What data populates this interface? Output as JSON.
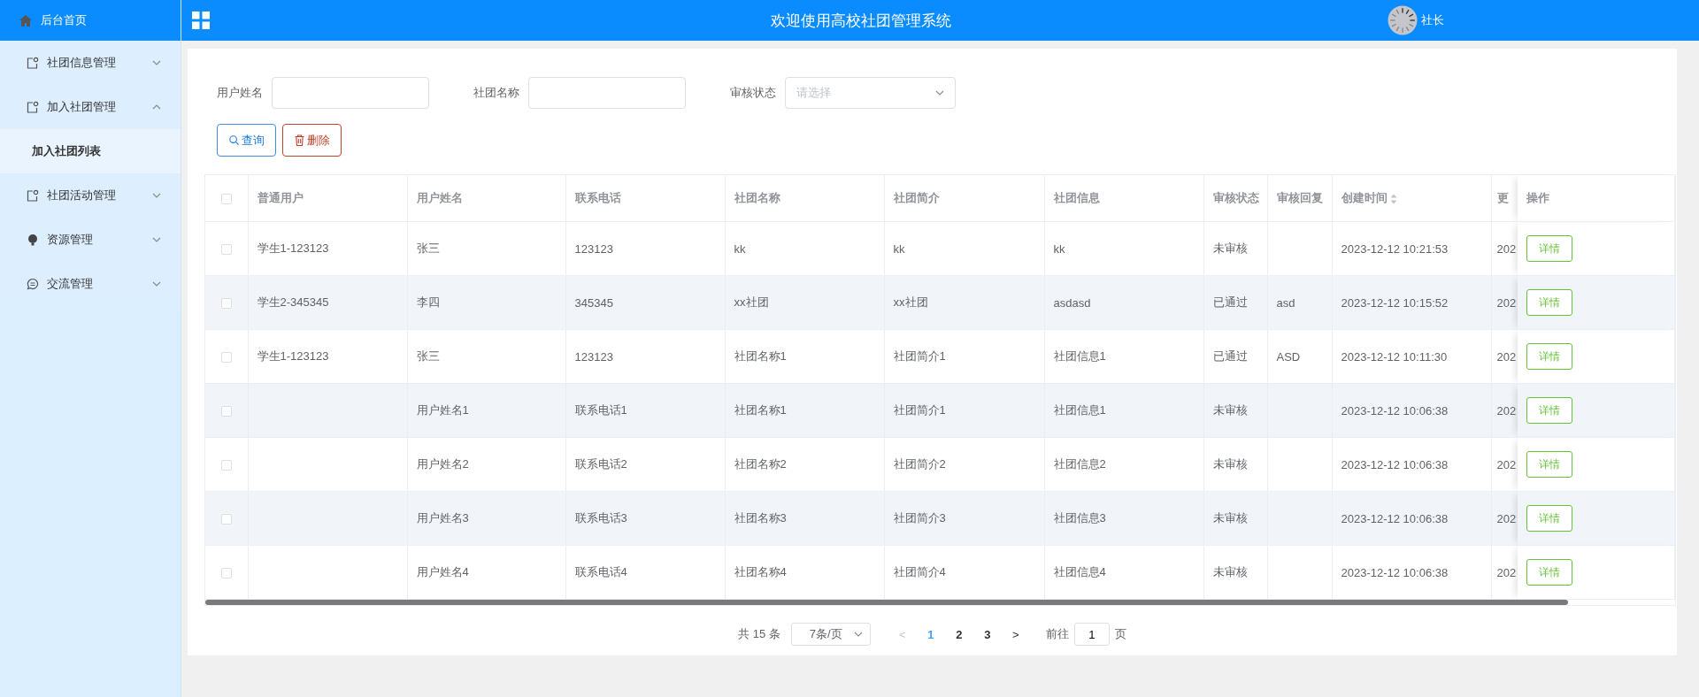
{
  "sidebar": {
    "home": "后台首页",
    "items": [
      {
        "label": "社团信息管理",
        "expanded": false
      },
      {
        "label": "加入社团管理",
        "expanded": true,
        "children": [
          {
            "label": "加入社团列表",
            "selected": true
          }
        ]
      },
      {
        "label": "社团活动管理",
        "expanded": false
      },
      {
        "label": "资源管理",
        "expanded": false
      },
      {
        "label": "交流管理",
        "expanded": false
      }
    ]
  },
  "topbar": {
    "title": "欢迎使用高校社团管理系统",
    "user": "社长"
  },
  "filters": [
    {
      "label": "用户姓名",
      "kind": "text"
    },
    {
      "label": "社团名称",
      "kind": "text"
    },
    {
      "label": "审核状态",
      "kind": "select",
      "placeholder": "请选择"
    }
  ],
  "buttons": [
    {
      "label": "查询",
      "kind": "search"
    },
    {
      "label": "删除",
      "kind": "delete"
    }
  ],
  "table": {
    "select_all": {
      "checked": false
    },
    "columns": [
      {
        "label": "普通用户",
        "kind": "plain"
      },
      {
        "label": "用户姓名",
        "kind": "plain"
      },
      {
        "label": "联系电话",
        "kind": "plain"
      },
      {
        "label": "社团名称",
        "kind": "plain"
      },
      {
        "label": "社团简介",
        "kind": "plain"
      },
      {
        "label": "社团信息",
        "kind": "plain"
      },
      {
        "label": "审核状态",
        "kind": "plain"
      },
      {
        "label": "审核回复",
        "kind": "plain"
      },
      {
        "label": "创建时间",
        "kind": "sortable"
      },
      {
        "label": "更",
        "kind": "plain"
      },
      {
        "label": "操作",
        "kind": "plain"
      }
    ],
    "rows": [
      {
        "checked": false,
        "cells": [
          "学生1-123123",
          "张三",
          "123123",
          "kk",
          "kk",
          "kk",
          "未审核",
          "",
          "2023-12-12 10:21:53",
          "202"
        ],
        "action": "详情"
      },
      {
        "checked": false,
        "cells": [
          "学生2-345345",
          "李四",
          "345345",
          "xx社团",
          "xx社团",
          "asdasd",
          "已通过",
          "asd",
          "2023-12-12 10:15:52",
          "202"
        ],
        "action": "详情"
      },
      {
        "checked": false,
        "cells": [
          "学生1-123123",
          "张三",
          "123123",
          "社团名称1",
          "社团简介1",
          "社团信息1",
          "已通过",
          "ASD",
          "2023-12-12 10:11:30",
          "202"
        ],
        "action": "详情"
      },
      {
        "checked": false,
        "cells": [
          "",
          "用户姓名1",
          "联系电话1",
          "社团名称1",
          "社团简介1",
          "社团信息1",
          "未审核",
          "",
          "2023-12-12 10:06:38",
          "202"
        ],
        "action": "详情"
      },
      {
        "checked": false,
        "cells": [
          "",
          "用户姓名2",
          "联系电话2",
          "社团名称2",
          "社团简介2",
          "社团信息2",
          "未审核",
          "",
          "2023-12-12 10:06:38",
          "202"
        ],
        "action": "详情"
      },
      {
        "checked": false,
        "cells": [
          "",
          "用户姓名3",
          "联系电话3",
          "社团名称3",
          "社团简介3",
          "社团信息3",
          "未审核",
          "",
          "2023-12-12 10:06:38",
          "202"
        ],
        "action": "详情"
      },
      {
        "checked": false,
        "cells": [
          "",
          "用户姓名4",
          "联系电话4",
          "社团名称4",
          "社团简介4",
          "社团信息4",
          "未审核",
          "",
          "2023-12-12 10:06:38",
          "202"
        ],
        "action": "详情"
      }
    ]
  },
  "pagination": {
    "total": "共 15 条",
    "page_size": "7条/页",
    "prev": "<",
    "next": ">",
    "pages": [
      {
        "label": "1",
        "selected": true
      },
      {
        "label": "2",
        "selected": false
      },
      {
        "label": "3",
        "selected": false
      }
    ],
    "goto_label": "前往",
    "goto_value": "1",
    "goto_suffix": "页"
  }
}
